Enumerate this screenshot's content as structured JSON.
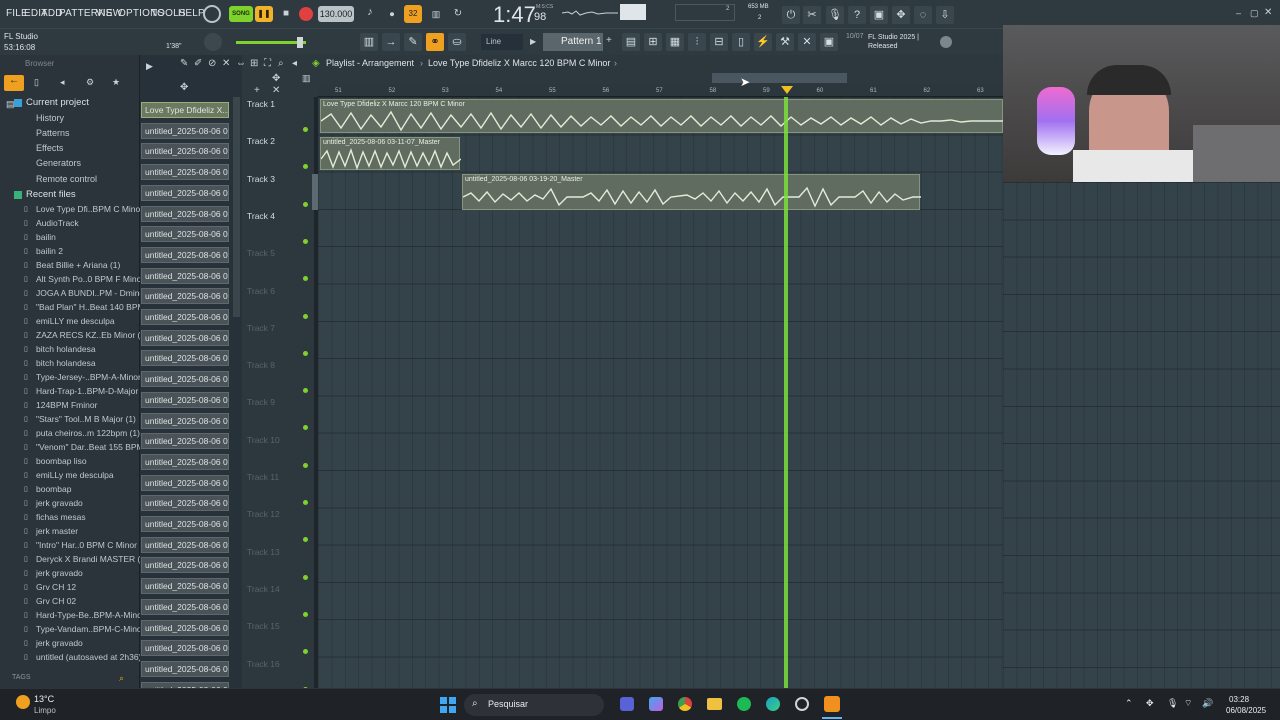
{
  "menu": [
    "FILE",
    "EDIT",
    "ADD",
    "PATTERNS",
    "VIEW",
    "OPTIONS",
    "TOOLS",
    "HELP"
  ],
  "transport": {
    "song_mode": "SONG",
    "tempo": "130.000",
    "time": "1:47",
    "time_sub": "98",
    "time_unit": "M:S:CS",
    "memory": "653 MB",
    "cpu": "2",
    "poly": "2"
  },
  "hint": {
    "title": "FL Studio",
    "time": "53:16:08",
    "beat": "1'38\""
  },
  "toolbar": {
    "snap": "Line",
    "pattern": "Pattern 1",
    "news_date": "10/07",
    "news_text": "FL Studio 2025 | Released"
  },
  "browser": {
    "label": "Browser",
    "sections": [
      "Current project",
      "Recent files"
    ],
    "project_items": [
      "History",
      "Patterns",
      "Effects",
      "Generators",
      "Remote control"
    ],
    "recent_files": [
      "Love Type Dfi..BPM C Minor",
      "AudioTrack",
      "bailin",
      "bailin 2",
      "Beat Billie + Ariana (1)",
      "Alt Synth Po..0 BPM F Minor",
      "JOGA A BUNDI..PM - Dminor",
      "\"Bad Plan\" H..Beat 140 BPM",
      "emiLLY me desculpa",
      "ZAZA RECS KZ..Eb Minor (1)",
      "bitch holandesa",
      "bitch holandesa",
      "Type-Jersey-..BPM-A-Minor",
      "Hard-Trap-1..BPM-D-Major",
      "124BPM Fminor",
      "\"Stars\" Tool..M B Major (1)",
      "puta cheiros..m 122bpm (1)",
      "\"Venom\" Dar..Beat 155 BPM",
      "boombap liso",
      "emiLLy me desculpa",
      "boombap",
      "jerk gravado",
      "fichas mesas",
      "jerk master",
      "\"Intro\" Har..0 BPM C Minor",
      "Deryck X Brandi MASTER (1)",
      "jerk gravado",
      "Grv CH 12",
      "Grv CH 02",
      "Hard-Type-Be..BPM-A-Minor",
      "Type-Vandam..BPM-C-Minor",
      "jerk gravado",
      "untitled (autosaved at 2h36)"
    ],
    "tags": "TAGS"
  },
  "channels": [
    "Love Type Dfideliz X...",
    "untitled_2025-08-06 01-",
    "untitled_2025-08-06 01-",
    "untitled_2025-08-06 01-",
    "untitled_2025-08-06 01-",
    "untitled_2025-08-06 01-",
    "untitled_2025-08-06 01-",
    "untitled_2025-08-06 01-",
    "untitled_2025-08-06 01-",
    "untitled_2025-08-06 01-",
    "untitled_2025-08-06 01-",
    "untitled_2025-08-06 01-",
    "untitled_2025-08-06 01-",
    "untitled_2025-08-06 02-",
    "untitled_2025-08-06 02-",
    "untitled_2025-08-06 02-",
    "untitled_2025-08-06 02-",
    "untitled_2025-08-06 02-",
    "untitled_2025-08-06 02-",
    "untitled_2025-08-06 02-",
    "untitled_2025-08-06 02-",
    "untitled_2025-08-06 02-",
    "untitled_2025-08-06 02-",
    "untitled_2025-08-06 02-",
    "untitled_2025-08-06 02-",
    "untitled_2025-08-06 02-",
    "untitled_2025-08-06 02-",
    "untitled_2025-08-06 02-",
    "untitled_2025-08-06 02-",
    "untitled_2025-08-06 02-"
  ],
  "playlist": {
    "title": "Playlist - Arrangement",
    "song": "Love Type Dfideliz X Marcc 120 BPM C Minor",
    "ruler": [
      "51",
      "52",
      "53",
      "54",
      "55",
      "56",
      "57",
      "58",
      "59",
      "60",
      "61",
      "62",
      "63"
    ],
    "tracks": [
      "Track 1",
      "Track 2",
      "Track 3",
      "Track 4",
      "Track 5",
      "Track 6",
      "Track 7",
      "Track 8",
      "Track 9",
      "Track 10",
      "Track 11",
      "Track 12",
      "Track 13",
      "Track 14",
      "Track 15",
      "Track 16"
    ],
    "clips": [
      "Love Type Dfideliz X Marcc 120 BPM C Minor",
      "untitled_2025-08-06 03-11-07_Master",
      "untitled_2025-08-06 03-19-20_Master"
    ]
  },
  "taskbar": {
    "temp": "13°C",
    "weather": "Limpo",
    "search": "Pesquisar",
    "clock_time": "03:28",
    "clock_date": "06/08/2025"
  },
  "colors": {
    "accent_green": "#7be13a",
    "panel": "#2e3940",
    "grid": "#34424a",
    "record": "#e04040",
    "pattern_orange": "#f0a020"
  }
}
